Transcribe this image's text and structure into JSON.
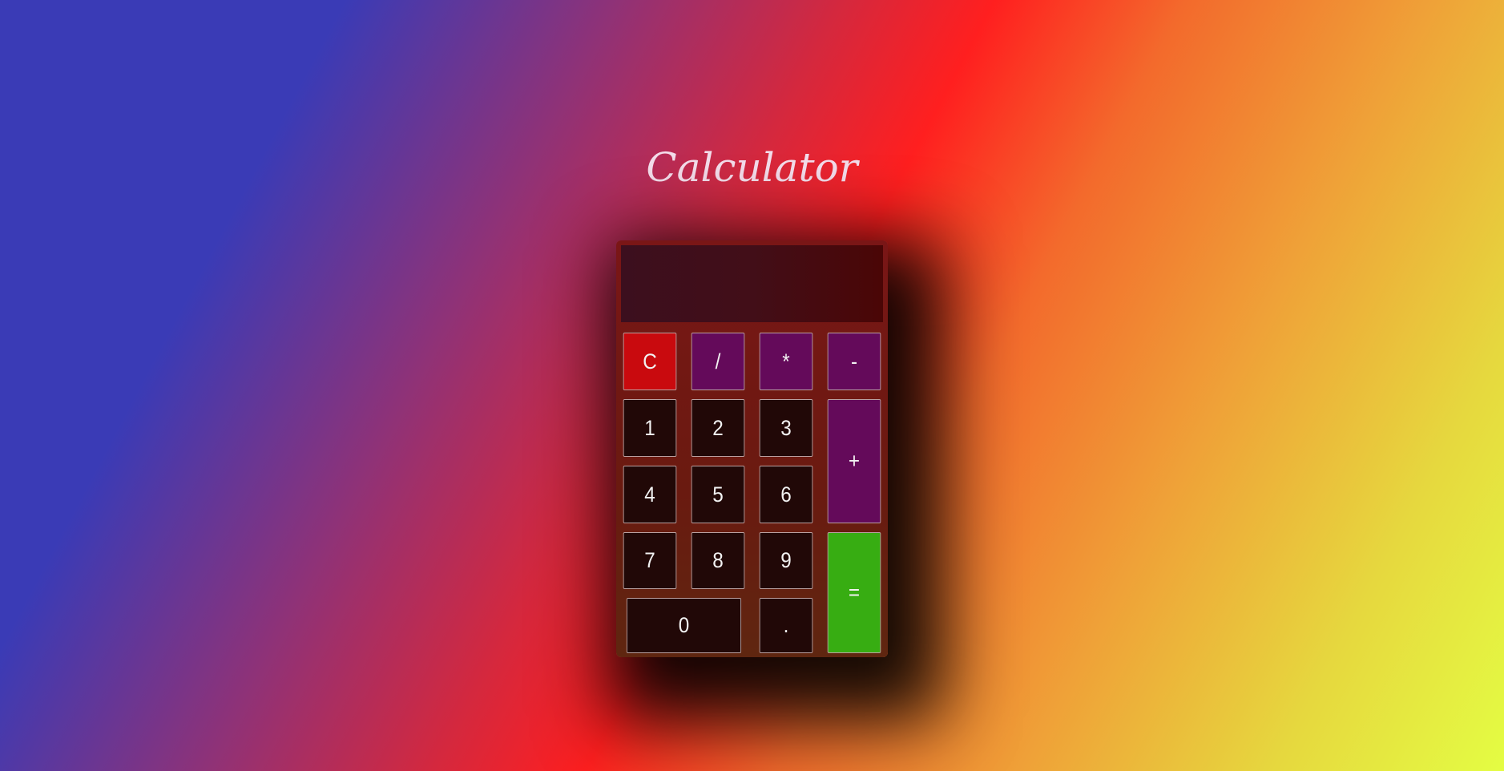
{
  "page": {
    "title": "Calculator"
  },
  "calculator": {
    "display_value": "",
    "keys": {
      "clear": "C",
      "divide": "/",
      "multiply": "*",
      "subtract": "-",
      "add": "+",
      "equals": "=",
      "decimal": ".",
      "d0": "0",
      "d1": "1",
      "d2": "2",
      "d3": "3",
      "d4": "4",
      "d5": "5",
      "d6": "6",
      "d7": "7",
      "d8": "8",
      "d9": "9"
    }
  },
  "colors": {
    "number_key": "#210807",
    "operator_key": "#640a5a",
    "clear_key": "#c90a0e",
    "equals_key": "#37ad12"
  }
}
